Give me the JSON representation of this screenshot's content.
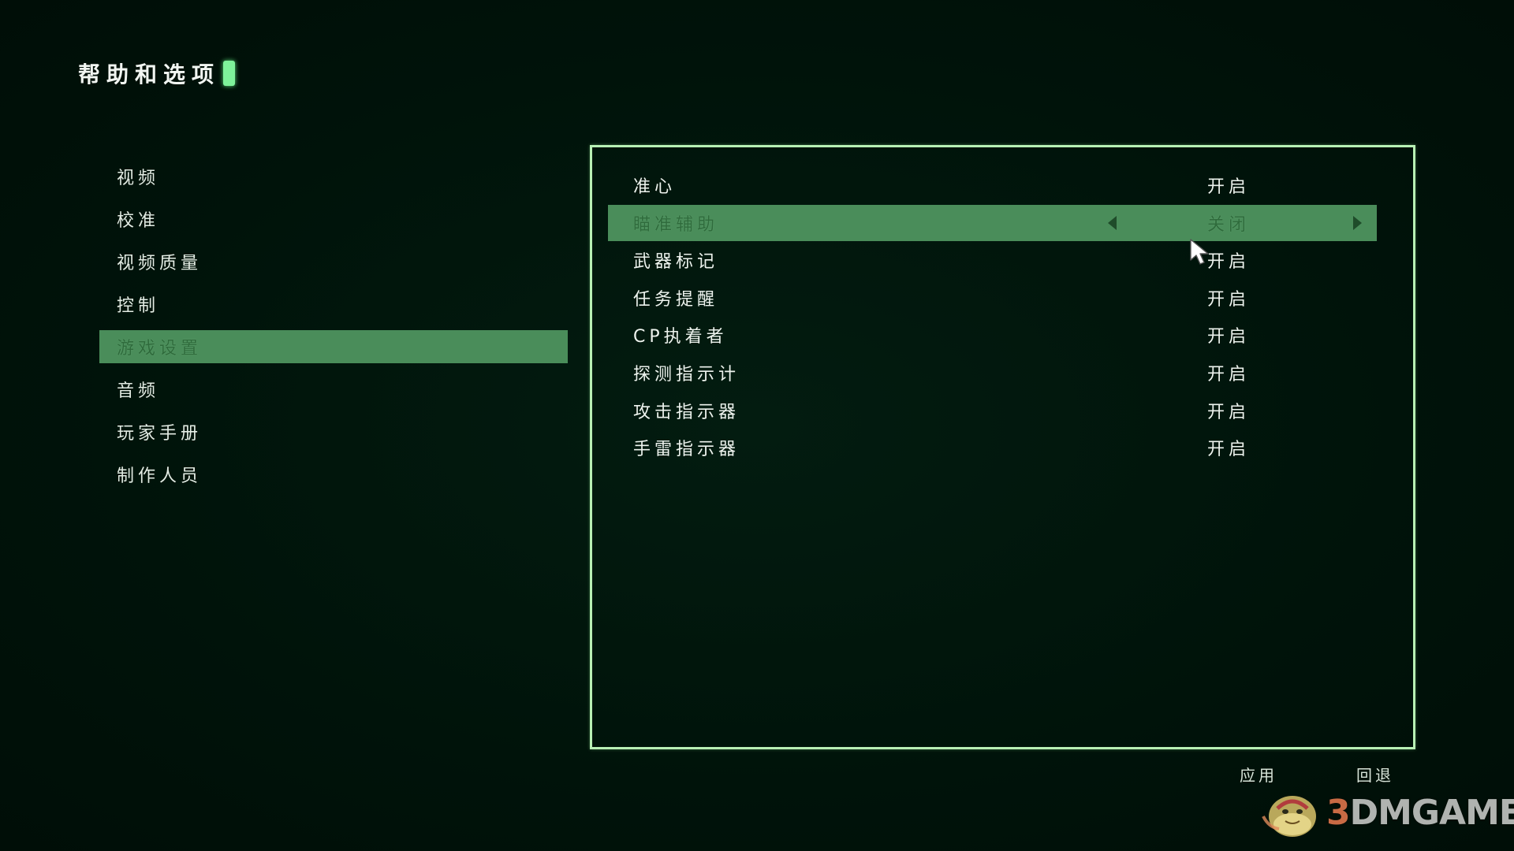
{
  "title": "帮助和选项",
  "sidebar": {
    "items": [
      {
        "label": "视频",
        "active": false
      },
      {
        "label": "校准",
        "active": false
      },
      {
        "label": "视频质量",
        "active": false
      },
      {
        "label": "控制",
        "active": false
      },
      {
        "label": "游戏设置",
        "active": true
      },
      {
        "label": "音频",
        "active": false
      },
      {
        "label": "玩家手册",
        "active": false
      },
      {
        "label": "制作人员",
        "active": false
      }
    ]
  },
  "settings": {
    "rows": [
      {
        "label": "准心",
        "value": "开启",
        "active": false
      },
      {
        "label": "瞄准辅助",
        "value": "关闭",
        "active": true
      },
      {
        "label": "武器标记",
        "value": "开启",
        "active": false
      },
      {
        "label": "任务提醒",
        "value": "开启",
        "active": false
      },
      {
        "label": "CP执着者",
        "value": "开启",
        "active": false
      },
      {
        "label": "探测指示计",
        "value": "开启",
        "active": false
      },
      {
        "label": "攻击指示器",
        "value": "开启",
        "active": false
      },
      {
        "label": "手雷指示器",
        "value": "开启",
        "active": false
      }
    ]
  },
  "footer": {
    "apply_label": "应用",
    "back_label": "回退"
  },
  "watermark": {
    "text_prefix": "3",
    "text_rest": "DMGAME"
  },
  "colors": {
    "background": "#00130a",
    "highlight": "#4a8d5a",
    "panel_border": "#b8f0b4",
    "title_block": "#7ef29a"
  },
  "icons": {
    "title_marker": "green-block-icon",
    "prev": "arrow-left-icon",
    "next": "arrow-right-icon",
    "pointer": "mouse-cursor-icon",
    "logo": "3dmgame-mascot-logo"
  }
}
